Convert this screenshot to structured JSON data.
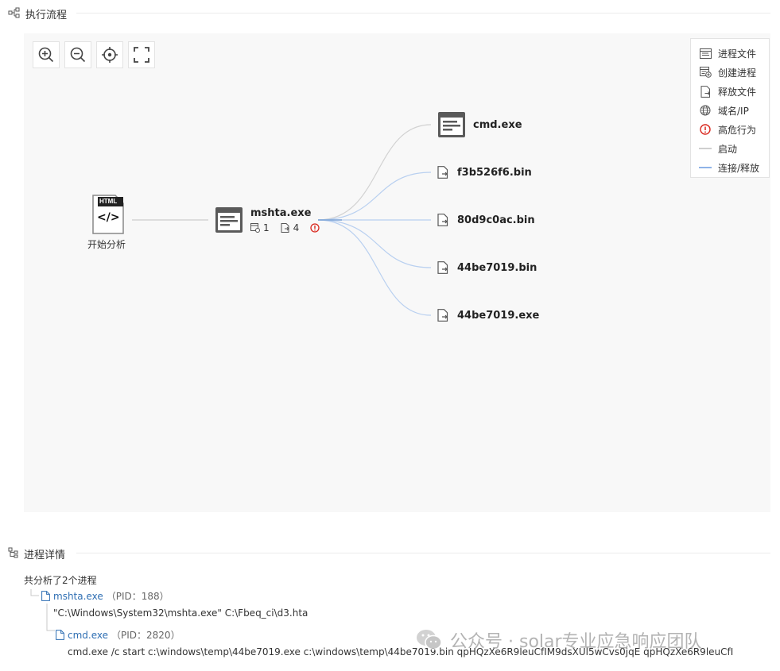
{
  "flow": {
    "title": "执行流程",
    "start_label": "开始分析",
    "html_badge": "HTML",
    "code_glyph": "</>",
    "root_process": {
      "name": "mshta.exe",
      "proc_count": "1",
      "file_count": "4"
    },
    "children": [
      {
        "name": "cmd.exe",
        "kind": "process"
      },
      {
        "name": "f3b526f6.bin",
        "kind": "file"
      },
      {
        "name": "80d9c0ac.bin",
        "kind": "file"
      },
      {
        "name": "44be7019.bin",
        "kind": "file"
      },
      {
        "name": "44be7019.exe",
        "kind": "file"
      }
    ],
    "toolbar": [
      {
        "name": "zoom-in-icon"
      },
      {
        "name": "zoom-out-icon"
      },
      {
        "name": "locate-icon"
      },
      {
        "name": "fullscreen-icon"
      }
    ],
    "legend": [
      {
        "icon": "process-file-icon",
        "label": "进程文件"
      },
      {
        "icon": "create-process-icon",
        "label": "创建进程"
      },
      {
        "icon": "release-file-icon",
        "label": "释放文件"
      },
      {
        "icon": "domain-ip-icon",
        "label": "域名/IP"
      },
      {
        "icon": "high-risk-icon",
        "label": "高危行为"
      },
      {
        "icon": "start-line",
        "label": "启动",
        "color": "#c8c8c8"
      },
      {
        "icon": "connect-line",
        "label": "连接/释放",
        "color": "#8fb3e8"
      }
    ]
  },
  "details": {
    "title": "进程详情",
    "summary": "共分析了2个进程",
    "processes": [
      {
        "name": "mshta.exe",
        "pid": "（PID：188）",
        "cmdline": "\"C:\\Windows\\System32\\mshta.exe\" C:\\Fbeq_ci\\d3.hta"
      },
      {
        "name": "cmd.exe",
        "pid": "（PID：2820）",
        "cmdline": "cmd.exe /c start c:\\windows\\temp\\44be7019.exe c:\\windows\\temp\\44be7019.bin qpHQzXe6R9leuCfIM9dsXUl5wCvs0jqE qpHQzXe6R9leuCfI"
      }
    ]
  },
  "watermark": "公众号 · solar专业应急响应团队",
  "colors": {
    "accent_link": "#2f6fb3",
    "danger": "#d9261c",
    "start_line": "#cfcfcf",
    "connect_line": "#a9c6ee"
  }
}
